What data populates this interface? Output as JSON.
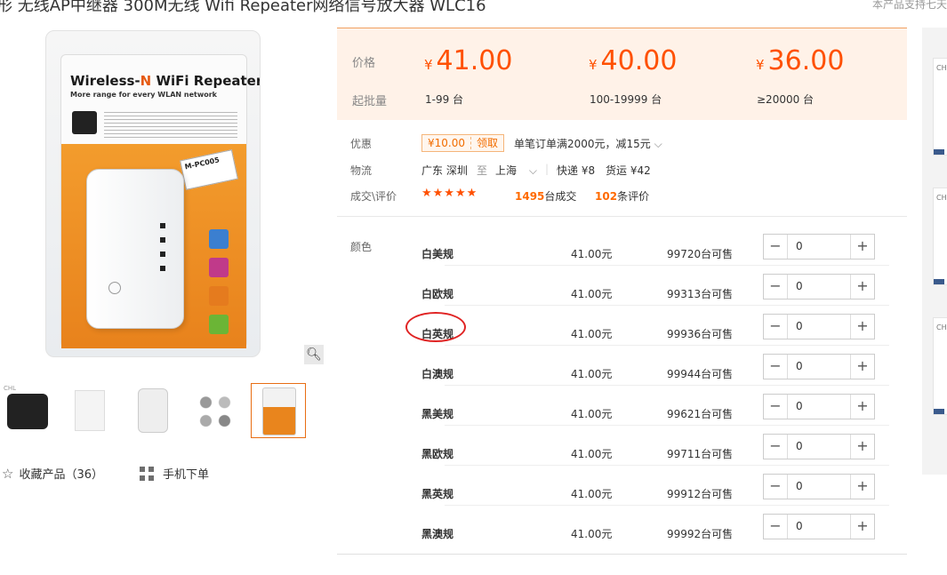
{
  "title": "形 无线AP中继器 300M无线 Wifi Repeater网络信号放大器 WLC16",
  "top_note": "本产品支持七天",
  "product_image": {
    "pkg_title_a": "Wireless-",
    "pkg_title_n": "N",
    "pkg_title_b": " WiFi Repeater",
    "pkg_subtitle": "More range for every WLAN network",
    "pkg_tag": "M-PC005"
  },
  "thumbnails": [
    {
      "caption": "CHL"
    },
    {
      "caption": ""
    },
    {
      "caption": ""
    },
    {
      "caption": ""
    },
    {
      "caption": ""
    }
  ],
  "actions": {
    "favorite_label": "收藏产品（36）",
    "mobile_label": "手机下单"
  },
  "price_panel": {
    "price_label": "价格",
    "moq_label": "起批量",
    "currency": "¥",
    "tiers": [
      {
        "price": "41.00",
        "qty": "1-99 台"
      },
      {
        "price": "40.00",
        "qty": "100-19999 台"
      },
      {
        "price": "36.00",
        "qty": "≥20000 台"
      }
    ]
  },
  "promo": {
    "label": "优惠",
    "coupon_amount": "¥10.00",
    "coupon_action": "领取",
    "discount_text": "单笔订单满2000元，减15元"
  },
  "logistics": {
    "label": "物流",
    "origin": "广东 深圳",
    "to": "至",
    "destination": "上海",
    "express": "快递 ¥8",
    "freight": "货运 ¥42"
  },
  "reviews": {
    "label": "成交\\评价",
    "stars": "★★★★★",
    "rating": 5,
    "deals_count": "1495",
    "deals_suffix": "台成交",
    "review_count": "102",
    "review_suffix": "条评价"
  },
  "sku": {
    "label": "颜色",
    "rows": [
      {
        "name": "白美规",
        "price": "41.00元",
        "stock": "99720台可售",
        "qty": "0"
      },
      {
        "name": "白欧规",
        "price": "41.00元",
        "stock": "99313台可售",
        "qty": "0"
      },
      {
        "name": "白英规",
        "price": "41.00元",
        "stock": "99936台可售",
        "qty": "0"
      },
      {
        "name": "白澳规",
        "price": "41.00元",
        "stock": "99944台可售",
        "qty": "0"
      },
      {
        "name": "黑美规",
        "price": "41.00元",
        "stock": "99621台可售",
        "qty": "0"
      },
      {
        "name": "黑欧规",
        "price": "41.00元",
        "stock": "99711台可售",
        "qty": "0"
      },
      {
        "name": "黑英规",
        "price": "41.00元",
        "stock": "99912台可售",
        "qty": "0"
      },
      {
        "name": "黑澳规",
        "price": "41.00元",
        "stock": "99992台可售",
        "qty": "0"
      }
    ],
    "minus_glyph": "−",
    "plus_glyph": "+"
  },
  "rec_captions": [
    "CHL",
    "CHL",
    "CHL"
  ],
  "colors": {
    "price_orange": "#ff5000",
    "panel_bg": "#fff2e8",
    "highlight_circle": "#e02424"
  }
}
